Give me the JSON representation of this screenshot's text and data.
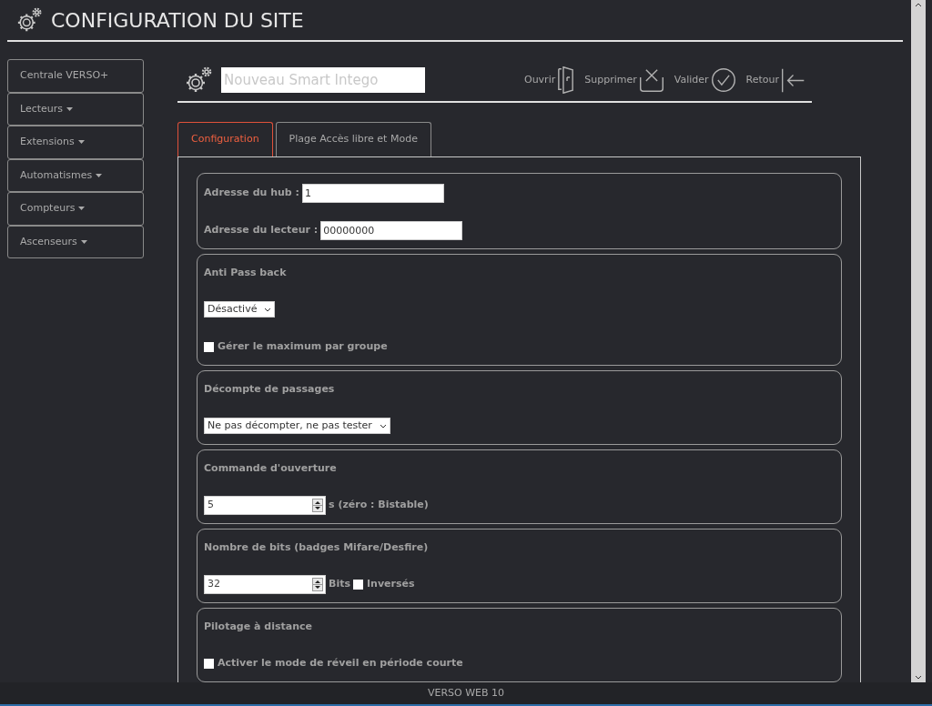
{
  "header": {
    "title": "CONFIGURATION DU SITE"
  },
  "sidebar": {
    "items": [
      {
        "label": "Centrale VERSO+",
        "has_caret": false
      },
      {
        "label": "Lecteurs",
        "has_caret": true
      },
      {
        "label": "Extensions",
        "has_caret": true
      },
      {
        "label": "Automatismes",
        "has_caret": true
      },
      {
        "label": "Compteurs",
        "has_caret": true
      },
      {
        "label": "Ascenseurs",
        "has_caret": true
      }
    ]
  },
  "toolbar": {
    "name_field": {
      "placeholder": "Nouveau Smart Intego"
    },
    "actions": [
      {
        "label": "Ouvrir",
        "kind": "open"
      },
      {
        "label": "Supprimer",
        "kind": "delete"
      },
      {
        "label": "Valider",
        "kind": "validate"
      },
      {
        "label": "Retour",
        "kind": "back"
      }
    ]
  },
  "tabs": [
    {
      "label": "Configuration",
      "selected": true
    },
    {
      "label": "Plage Accès libre et Mode",
      "selected": false
    }
  ],
  "sections": [
    {
      "fields": [
        {
          "kind": "text",
          "label": "Adresse du hub :",
          "value": "1"
        },
        {
          "kind": "text",
          "label": "Adresse du lecteur :",
          "value": "00000000"
        }
      ]
    },
    {
      "title": "Anti Pass back",
      "fields": [
        {
          "kind": "select",
          "value": "Désactivé"
        },
        {
          "kind": "checkbox",
          "label": "Gérer le maximum par groupe",
          "checked": false
        }
      ]
    },
    {
      "title": "Décompte de passages",
      "fields": [
        {
          "kind": "select",
          "value": "Ne pas décompter, ne pas tester"
        }
      ]
    },
    {
      "title": "Commande d'ouverture",
      "fields": [
        {
          "kind": "number",
          "value": "5",
          "unit": "s (zéro : Bistable)"
        }
      ]
    },
    {
      "title": "Nombre de bits (badges Mifare/Desfire)",
      "fields": [
        {
          "kind": "number",
          "value": "32",
          "unit": "Bits",
          "checkbox": {
            "label": "Inversés",
            "checked": false
          }
        }
      ]
    },
    {
      "title": "Pilotage à distance",
      "fields": [
        {
          "kind": "checkbox",
          "label": "Activer le mode de réveil en période courte",
          "checked": false
        }
      ]
    }
  ],
  "footer": {
    "text": "VERSO WEB 10"
  }
}
